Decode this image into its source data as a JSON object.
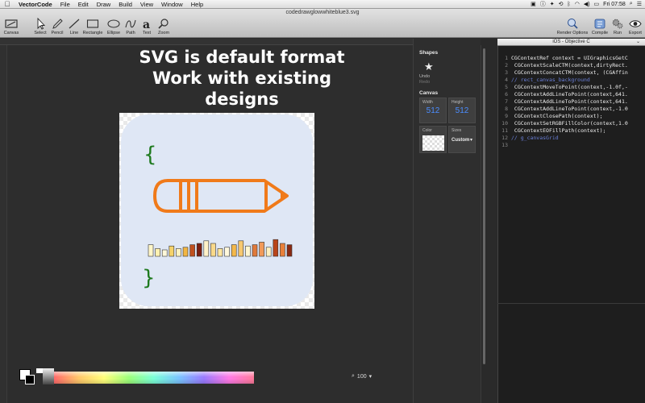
{
  "menubar": {
    "app_name": "VectorCode",
    "items": [
      "File",
      "Edit",
      "Draw",
      "Build",
      "View",
      "Window",
      "Help"
    ],
    "clock": "Fri 07:58"
  },
  "window": {
    "title": "codedrawglowwhiteblue3.svg"
  },
  "toolbar": {
    "canvas": "Canvas",
    "tools": [
      "Select",
      "Pencil",
      "Line",
      "Rectangle",
      "Ellipse",
      "Path",
      "Text",
      "Zoom"
    ],
    "render_options": "Render Options",
    "compile": "Compile",
    "run": "Run",
    "export": "Export"
  },
  "headline": [
    "SVG is default format",
    "Work with existing",
    "designs"
  ],
  "inspector": {
    "shapes_label": "Shapes",
    "undo_label": "Undo",
    "redo_label": "Redo",
    "canvas_label": "Canvas",
    "width_label": "Width",
    "width_value": "512",
    "height_label": "Height",
    "height_value": "512",
    "color_label": "Color",
    "sizes_label": "Sizes",
    "sizes_value": "Custom"
  },
  "zoom": {
    "value": "100"
  },
  "code": {
    "language": "iOS - Objective C",
    "lines": [
      {
        "n": "1",
        "text": "CGContextRef context = UIGraphicsGetC",
        "comment": false
      },
      {
        "n": "2",
        "text": " CGContextScaleCTM(context,dirtyRect.",
        "comment": false
      },
      {
        "n": "3",
        "text": " CGContextConcatCTM(context, (CGAffin",
        "comment": false
      },
      {
        "n": "4",
        "text": "// rect_canvas_background",
        "comment": true
      },
      {
        "n": "5",
        "text": " CGContextMoveToPoint(context,-1.0f,-",
        "comment": false
      },
      {
        "n": "6",
        "text": " CGContextAddLineToPoint(context,641.",
        "comment": false
      },
      {
        "n": "7",
        "text": " CGContextAddLineToPoint(context,641.",
        "comment": false
      },
      {
        "n": "8",
        "text": " CGContextAddLineToPoint(context,-1.0",
        "comment": false
      },
      {
        "n": "9",
        "text": " CGContextClosePath(context);",
        "comment": false
      },
      {
        "n": "10",
        "text": " CGContextSetRGBFillColor(context,1.0",
        "comment": false
      },
      {
        "n": "11",
        "text": " CGContextEOFillPath(context);",
        "comment": false
      },
      {
        "n": "12",
        "text": "// g_canvasGrid",
        "comment": true
      },
      {
        "n": "13",
        "text": "",
        "comment": false
      }
    ]
  },
  "artwork": {
    "brace_open": "{",
    "brace_close": "}",
    "bar_levels": [
      0.45,
      0.3,
      0.25,
      0.4,
      0.3,
      0.35,
      0.45,
      0.5,
      0.6,
      0.5,
      0.3,
      0.35,
      0.45,
      0.6,
      0.4,
      0.45,
      0.55,
      0.35,
      0.65,
      0.5,
      0.45
    ],
    "colors": {
      "brace": "#1e7a1e",
      "pencil": "#f07a1a",
      "artboard_bg": "#dfe7f5",
      "code_bg": "#1e1e1e",
      "number_blue": "#4b8dff"
    }
  }
}
